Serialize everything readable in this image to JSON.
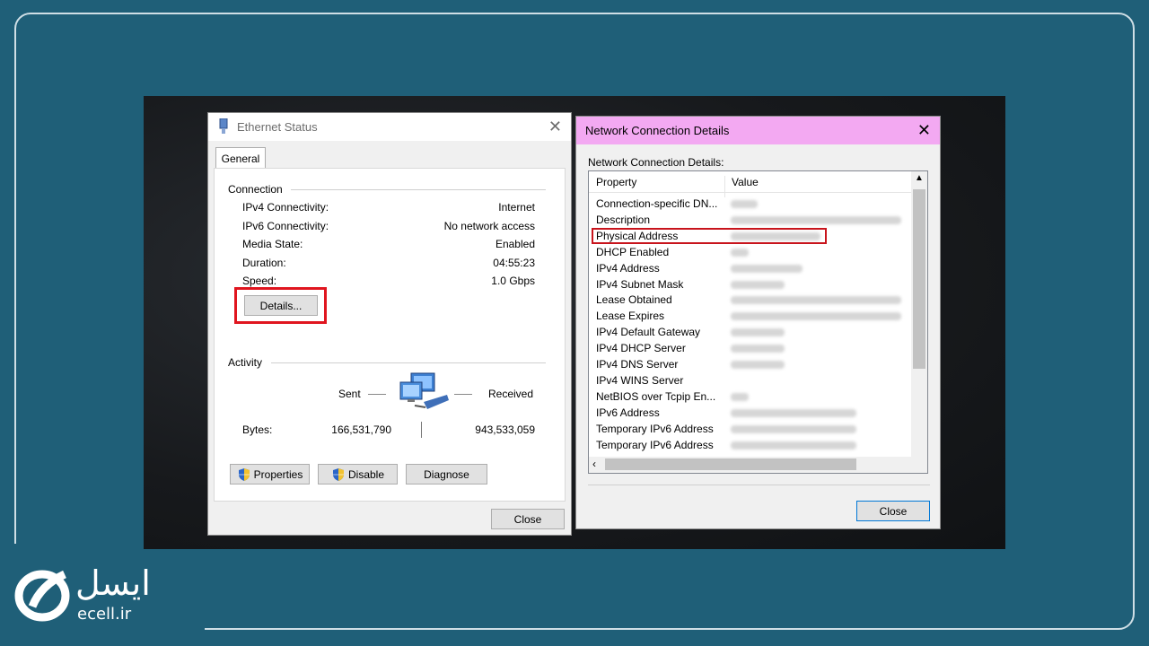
{
  "ethernet_status": {
    "title": "Ethernet Status",
    "tab": "General",
    "connection_group": "Connection",
    "rows": [
      {
        "label": "IPv4 Connectivity:",
        "value": "Internet"
      },
      {
        "label": "IPv6 Connectivity:",
        "value": "No network access"
      },
      {
        "label": "Media State:",
        "value": "Enabled"
      },
      {
        "label": "Duration:",
        "value": "04:55:23"
      },
      {
        "label": "Speed:",
        "value": "1.0 Gbps"
      }
    ],
    "details_button": "Details...",
    "activity_group": "Activity",
    "sent_label": "Sent",
    "received_label": "Received",
    "bytes_label": "Bytes:",
    "bytes_sent": "166,531,790",
    "bytes_received": "943,533,059",
    "properties_button": "Properties",
    "disable_button": "Disable",
    "diagnose_button": "Diagnose",
    "close_button": "Close"
  },
  "ncd": {
    "title": "Network Connection Details",
    "subtitle": "Network Connection Details:",
    "col_property": "Property",
    "col_value": "Value",
    "rows": [
      "Connection-specific DN...",
      "Description",
      "Physical Address",
      "DHCP Enabled",
      "IPv4 Address",
      "IPv4 Subnet Mask",
      "Lease Obtained",
      "Lease Expires",
      "IPv4 Default Gateway",
      "IPv4 DHCP Server",
      "IPv4 DNS Server",
      "IPv4 WINS Server",
      "NetBIOS over Tcpip En...",
      "IPv6 Address",
      "Temporary IPv6 Address",
      "Temporary IPv6 Address"
    ],
    "close_button": "Close"
  },
  "brand": {
    "site": "ecell.ir",
    "name_fa": "ایسل"
  },
  "colors": {
    "background": "#1f5f78",
    "highlight": "#e0151f",
    "ncd_titlebar": "#f3a9f2"
  }
}
